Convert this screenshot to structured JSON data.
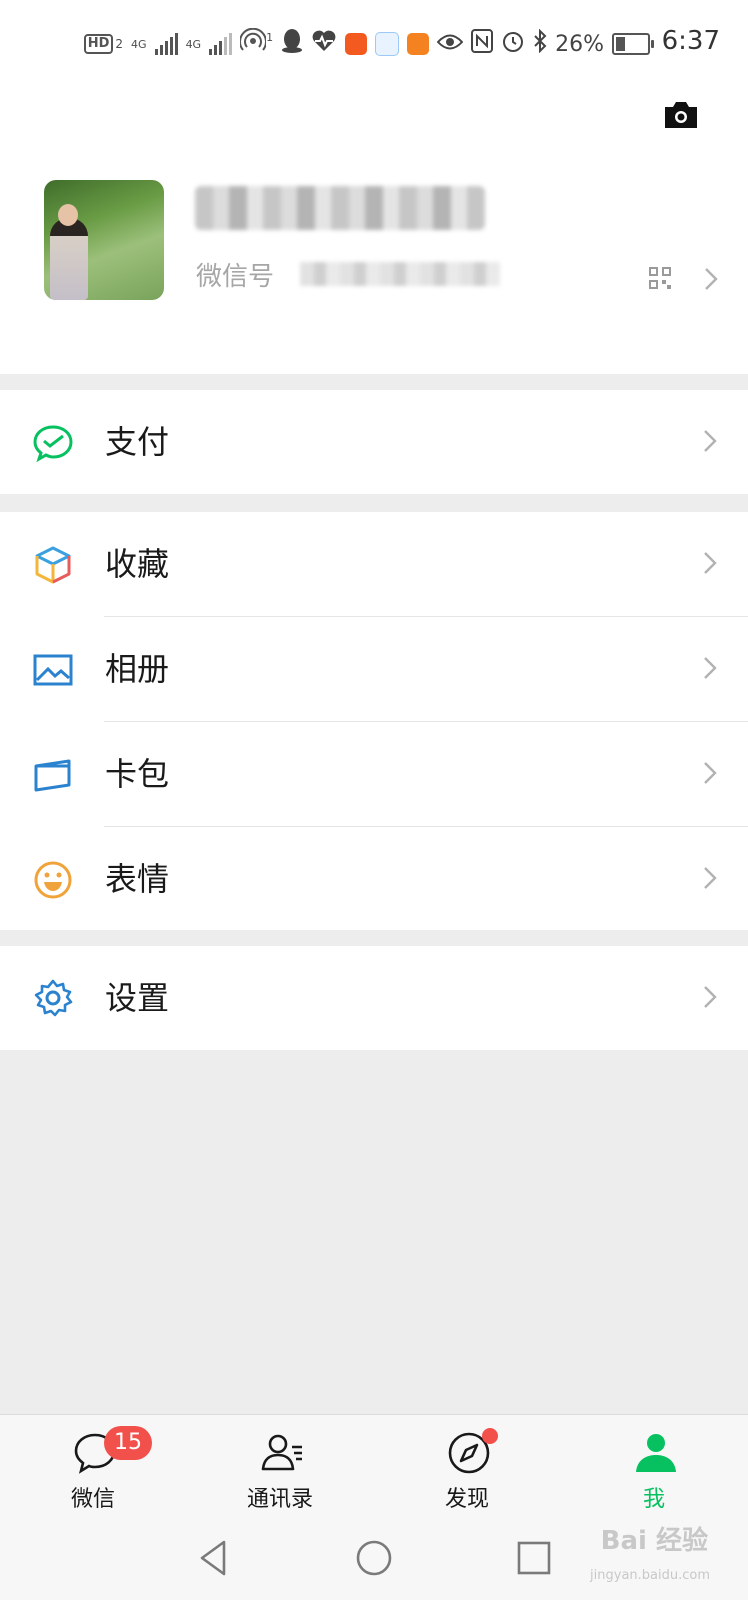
{
  "status_bar": {
    "hd_label": "HD",
    "hd_sub": "2",
    "net1": "4G",
    "net2": "4G",
    "hotspot_sub": "1",
    "battery_percent": "26%",
    "time": "6:37"
  },
  "profile": {
    "wechat_id_label": "微信号"
  },
  "menu": {
    "pay": "支付",
    "favorites": "收藏",
    "album": "相册",
    "cards": "卡包",
    "stickers": "表情",
    "settings": "设置"
  },
  "tabs": {
    "chats": "微信",
    "chats_badge": "15",
    "contacts": "通讯录",
    "discover": "发现",
    "me": "我"
  },
  "colors": {
    "brand_green": "#07c160",
    "badge_red": "#f2504b",
    "background": "#ededed"
  },
  "watermark": {
    "text": "Bai 经验",
    "url": "jingyan.baidu.com"
  }
}
